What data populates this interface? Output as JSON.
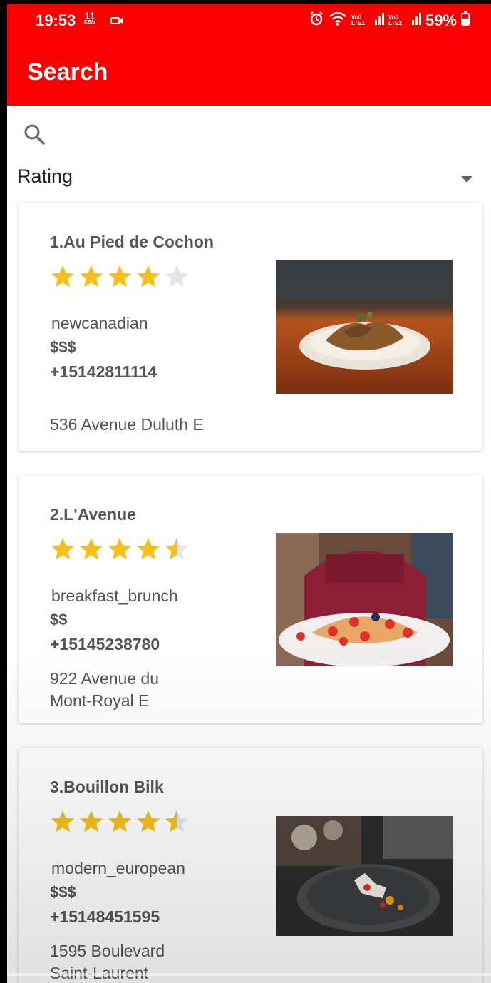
{
  "status_bar": {
    "time": "19:53",
    "speed_value": "11",
    "speed_unit": "KB/s",
    "lte1": "Vo0 LTE1",
    "lte2": "Vo0 LTE2",
    "battery": "59%",
    "icons": [
      "video-icon",
      "alarm-icon",
      "wifi-icon",
      "signal-icon",
      "battery-icon"
    ]
  },
  "app_bar": {
    "title": "Search",
    "color": "#fa0000"
  },
  "search": {
    "icon": "search-icon"
  },
  "sort": {
    "label": "Rating",
    "icon": "caret-down-icon"
  },
  "star_colors": {
    "filled": "#f4c01e",
    "empty": "#e4e4e4"
  },
  "restaurants": [
    {
      "name": "1.Au Pied de Cochon",
      "rating": 4,
      "category": "newcanadian",
      "price": "$$$",
      "phone": "+15142811114",
      "address_line1": "536 Avenue Duluth E",
      "address_line2": ""
    },
    {
      "name": "2.L'Avenue",
      "rating": 4.5,
      "category": "breakfast_brunch",
      "price": "$$",
      "phone": "+15145238780",
      "address_line1": "922 Avenue du",
      "address_line2": "Mont-Royal E"
    },
    {
      "name": "3.Bouillon Bilk",
      "rating": 4.5,
      "category": "modern_european",
      "price": "$$$",
      "phone": "+15148451595",
      "address_line1": "1595 Boulevard",
      "address_line2": "Saint-Laurent"
    }
  ]
}
